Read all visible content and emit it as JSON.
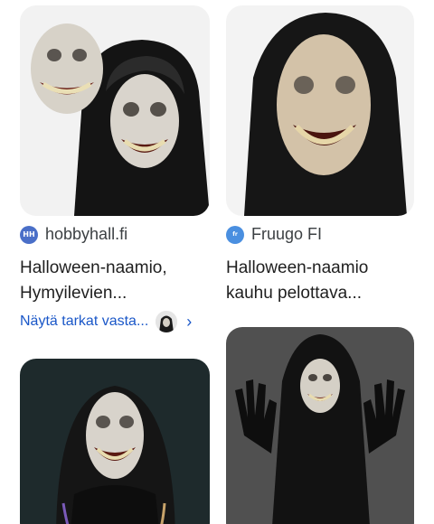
{
  "results": [
    {
      "source": "hobbyhall.fi",
      "source_icon": "hobbyhall-logo-icon",
      "title_line1": "Halloween-naamio,",
      "title_line2": "Hymyilevien..."
    },
    {
      "source": "Fruugo FI",
      "source_icon": "fruugo-logo-icon",
      "title_line1": "Halloween-naamio",
      "title_line2": "kauhu pelottava..."
    }
  ],
  "more_link": {
    "label": "Näytä tarkat vasta...",
    "chevron": "›"
  },
  "colors": {
    "link": "#1a57c8",
    "text": "#1f1f1f",
    "source_text": "#3c4043"
  }
}
